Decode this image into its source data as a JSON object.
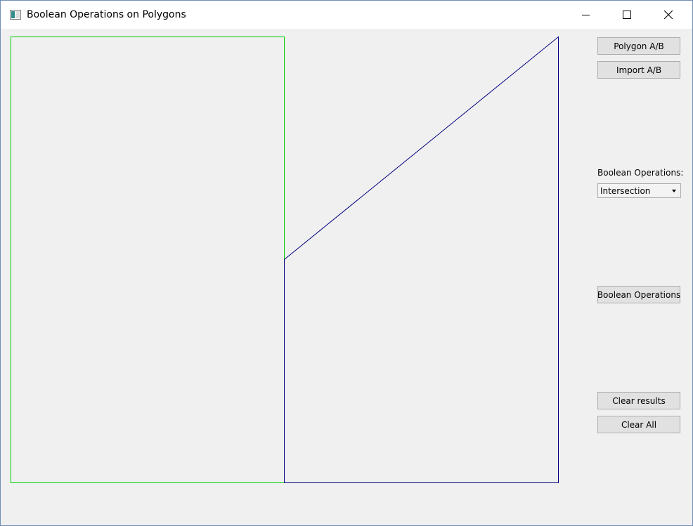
{
  "window": {
    "title": "Boolean Operations on Polygons"
  },
  "icons": {
    "app": "app-window-icon",
    "minimize": "minimize-icon",
    "maximize": "maximize-icon",
    "close": "close-icon"
  },
  "colors": {
    "polygon_a": "#00cc00",
    "polygon_b": "#000080",
    "background": "#f0f0f0"
  },
  "toolbar": {
    "polygon_ab_label": "Polygon A/B",
    "import_ab_label": "Import A/B",
    "operations_label": "Boolean Operations:",
    "operation_selected": "Intersection",
    "run_operations_label": "Boolean Operations",
    "clear_results_label": "Clear results",
    "clear_all_label": "Clear All"
  }
}
